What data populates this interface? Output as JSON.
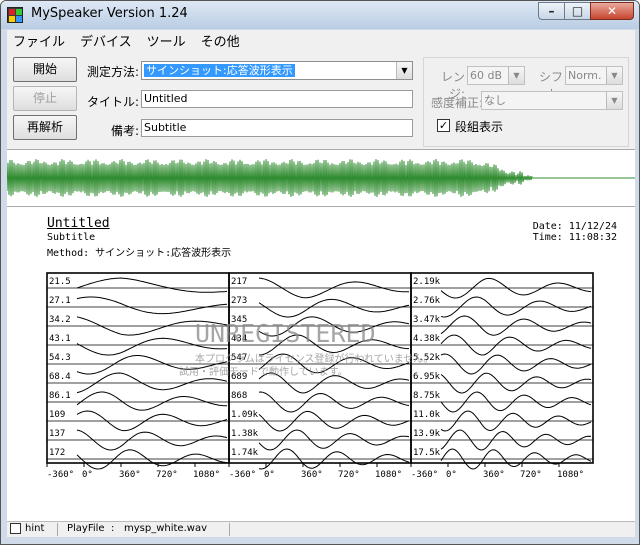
{
  "window": {
    "title": "MySpeaker Version 1.24"
  },
  "menu": [
    "ファイル",
    "デバイス",
    "ツール",
    "その他"
  ],
  "buttons": {
    "start": "開始",
    "stop": "停止",
    "reanalyze": "再解析"
  },
  "form": {
    "method_label": "測定方法:",
    "method_value": "サインショット:応答波形表示",
    "title_label": "タイトル:",
    "title_value": "Untitled",
    "note_label": "備考:",
    "note_value": "Subtitle"
  },
  "options": {
    "range_label": "レンジ:",
    "range_value": "60 dB",
    "shift_label": "シフト:",
    "shift_value": "Norm.",
    "sensitivity_label": "感度補正:",
    "sensitivity_value": "なし",
    "stacked_label": "段組表示",
    "stacked_checked": "✓"
  },
  "colors": {
    "waveform": "#2e8b2e",
    "accent": "#3399ff"
  },
  "report": {
    "title": "Untitled",
    "subtitle": "Subtitle",
    "method": "Method: サインショット:応答波形表示",
    "date": "Date: 11/12/24",
    "time": "Time: 11:08:32",
    "watermark": "UNREGISTERED",
    "notice1": "本プログラムはライセンス登録が行われていません。",
    "notice2": "試用・評価モードで動作しています。"
  },
  "chart_data": {
    "type": "line",
    "xlabel_ticks": [
      "-360°",
      "0°",
      "360°",
      "720°",
      "1080°"
    ],
    "panels": [
      {
        "frequencies": [
          "21.5",
          "27.1",
          "34.2",
          "43.1",
          "54.3",
          "68.4",
          "86.1",
          "109",
          "137",
          "172"
        ]
      },
      {
        "frequencies": [
          "217",
          "273",
          "345",
          "434",
          "547",
          "689",
          "868",
          "1.09k",
          "1.38k",
          "1.74k"
        ]
      },
      {
        "frequencies": [
          "2.19k",
          "2.76k",
          "3.47k",
          "4.38k",
          "5.52k",
          "6.95k",
          "8.75k",
          "11.0k",
          "13.9k",
          "17.5k"
        ]
      }
    ]
  },
  "status": {
    "hint_label": "hint",
    "playfile_label": "PlayFile",
    "playfile_sep": ":",
    "playfile_value": "mysp_white.wav"
  }
}
